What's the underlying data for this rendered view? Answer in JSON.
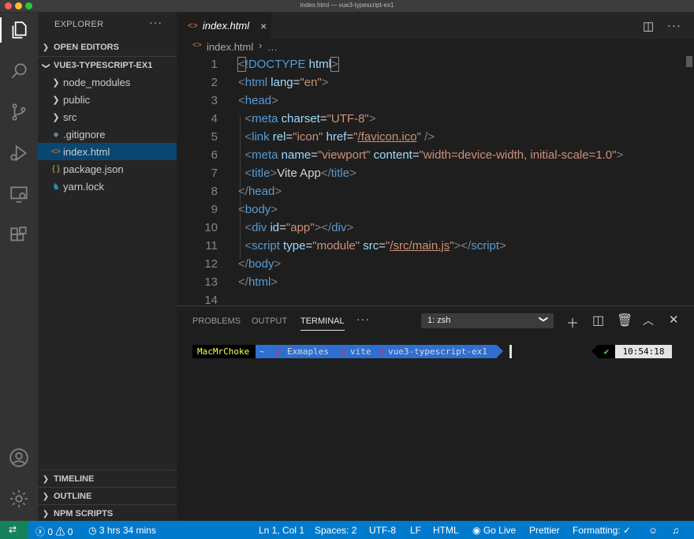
{
  "window": {
    "title": "index.html — vue3-typescript-ex1"
  },
  "colors": {
    "accent": "#007acc",
    "remote": "#16825d",
    "selection": "#094771"
  },
  "activity_bar": [
    "files-icon",
    "search-icon",
    "source-control-icon",
    "run-debug-icon",
    "remote-explorer-icon",
    "extensions-icon",
    "account-icon",
    "settings-gear-icon"
  ],
  "sidebar": {
    "title": "EXPLORER",
    "more": "···",
    "open_editors": "OPEN EDITORS",
    "project": "VUE3-TYPESCRIPT-EX1",
    "items": [
      {
        "label": "node_modules",
        "type": "folder"
      },
      {
        "label": "public",
        "type": "folder"
      },
      {
        "label": "src",
        "type": "folder"
      },
      {
        "label": ".gitignore",
        "type": "file",
        "icon": "◆"
      },
      {
        "label": "index.html",
        "type": "file",
        "icon": "<>"
      },
      {
        "label": "package.json",
        "type": "file",
        "icon": "{ }"
      },
      {
        "label": "yarn.lock",
        "type": "file",
        "icon": "♞"
      }
    ],
    "timeline": "TIMELINE",
    "outline": "OUTLINE",
    "npm_scripts": "NPM SCRIPTS"
  },
  "editor": {
    "tab_label": "index.html",
    "tab_close": "×",
    "breadcrumb_file": "index.html",
    "breadcrumb_more": "…",
    "line_numbers": [
      "1",
      "2",
      "3",
      "4",
      "5",
      "6",
      "7",
      "8",
      "9",
      "10",
      "11",
      "12",
      "13",
      "14"
    ]
  },
  "panel": {
    "tabs": [
      "PROBLEMS",
      "OUTPUT",
      "TERMINAL"
    ],
    "active_tab": "TERMINAL",
    "more": "···",
    "terminal_select": "1: zsh",
    "prompt": {
      "user": "MacMrChoke",
      "home": "~",
      "path": [
        "Exmaples",
        "vite",
        "vue3-typescript-ex1"
      ],
      "check": "✔",
      "time": "10:54:18"
    }
  },
  "status": {
    "errors": "0",
    "warnings": "0",
    "time_spent": "3 hrs 34 mins",
    "cursor": "Ln 1, Col 1",
    "spaces": "Spaces: 2",
    "encoding": "UTF-8",
    "eol": "LF",
    "language": "HTML",
    "go_live": "Go Live",
    "prettier": "Prettier",
    "formatting": "Formatting: ✓"
  }
}
